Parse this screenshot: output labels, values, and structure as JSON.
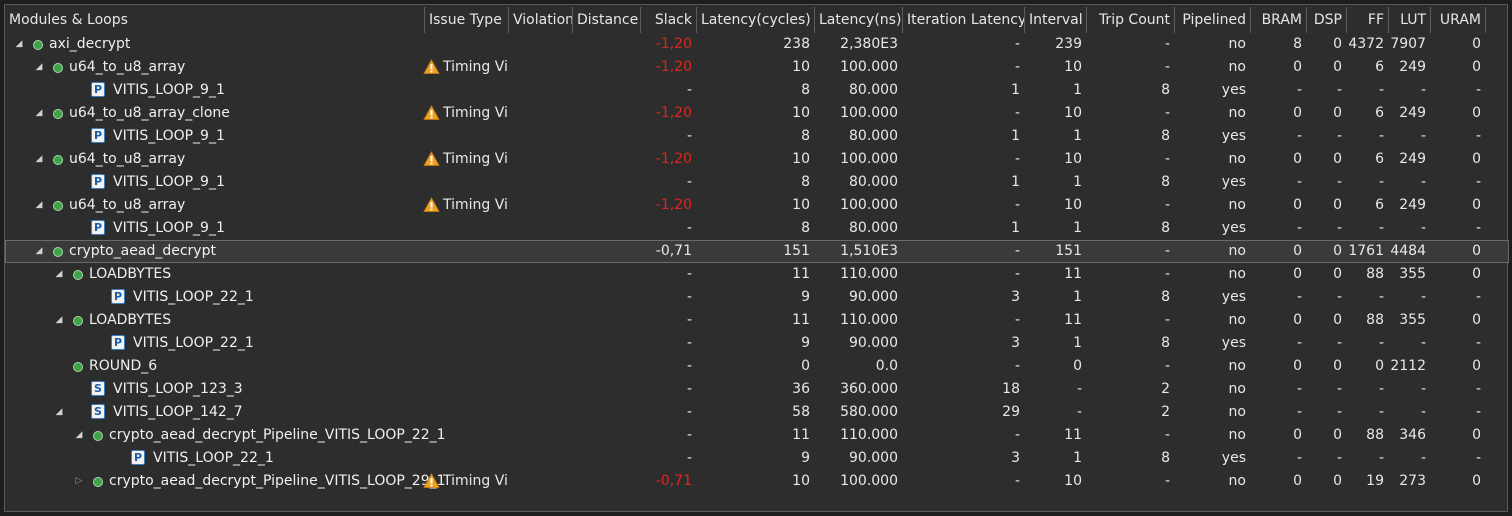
{
  "headers": [
    "Modules & Loops",
    "Issue Type",
    "Violation",
    "Distance",
    "Slack",
    "Latency(cycles)",
    "Latency(ns)",
    "Iteration Latency",
    "Interval",
    "Trip Count",
    "Pipelined",
    "BRAM",
    "DSP",
    "FF",
    "LUT",
    "URAM"
  ],
  "colors": {
    "negative_slack": "#e0251c",
    "module_dot": "#3fa24a",
    "warning": "#f0a020"
  },
  "icons": {
    "expanded": "triangle-down-icon",
    "collapsed": "triangle-right-icon",
    "module": "module-dot-icon",
    "pipelined_loop": "pipelined-loop-icon",
    "sequential_loop": "sequential-loop-icon",
    "warning": "warning-icon"
  },
  "rows": [
    {
      "level": 0,
      "arrow": "expanded",
      "icon": "dot",
      "name": "axi_decrypt",
      "issue": "",
      "slack": "-1,20",
      "lat_cycles": "238",
      "lat_ns": "2,380E3",
      "iter_lat": "-",
      "interval": "239",
      "trip": "-",
      "pipelined": "no",
      "bram": "8",
      "dsp": "0",
      "ff": "4372",
      "lut": "7907",
      "uram": "0"
    },
    {
      "level": 1,
      "arrow": "expanded",
      "icon": "dot",
      "name": "u64_to_u8_array",
      "issue": "Timing Vi",
      "slack": "-1,20",
      "lat_cycles": "10",
      "lat_ns": "100.000",
      "iter_lat": "-",
      "interval": "10",
      "trip": "-",
      "pipelined": "no",
      "bram": "0",
      "dsp": "0",
      "ff": "6",
      "lut": "249",
      "uram": "0"
    },
    {
      "level": 2,
      "arrow": "",
      "icon": "P",
      "name": "VITIS_LOOP_9_1",
      "issue": "",
      "slack": "-",
      "lat_cycles": "8",
      "lat_ns": "80.000",
      "iter_lat": "1",
      "interval": "1",
      "trip": "8",
      "pipelined": "yes",
      "bram": "-",
      "dsp": "-",
      "ff": "-",
      "lut": "-",
      "uram": "-"
    },
    {
      "level": 1,
      "arrow": "expanded",
      "icon": "dot",
      "name": "u64_to_u8_array_clone",
      "issue": "Timing Vi",
      "slack": "-1,20",
      "lat_cycles": "10",
      "lat_ns": "100.000",
      "iter_lat": "-",
      "interval": "10",
      "trip": "-",
      "pipelined": "no",
      "bram": "0",
      "dsp": "0",
      "ff": "6",
      "lut": "249",
      "uram": "0"
    },
    {
      "level": 2,
      "arrow": "",
      "icon": "P",
      "name": "VITIS_LOOP_9_1",
      "issue": "",
      "slack": "-",
      "lat_cycles": "8",
      "lat_ns": "80.000",
      "iter_lat": "1",
      "interval": "1",
      "trip": "8",
      "pipelined": "yes",
      "bram": "-",
      "dsp": "-",
      "ff": "-",
      "lut": "-",
      "uram": "-"
    },
    {
      "level": 1,
      "arrow": "expanded",
      "icon": "dot",
      "name": "u64_to_u8_array",
      "issue": "Timing Vi",
      "slack": "-1,20",
      "lat_cycles": "10",
      "lat_ns": "100.000",
      "iter_lat": "-",
      "interval": "10",
      "trip": "-",
      "pipelined": "no",
      "bram": "0",
      "dsp": "0",
      "ff": "6",
      "lut": "249",
      "uram": "0"
    },
    {
      "level": 2,
      "arrow": "",
      "icon": "P",
      "name": "VITIS_LOOP_9_1",
      "issue": "",
      "slack": "-",
      "lat_cycles": "8",
      "lat_ns": "80.000",
      "iter_lat": "1",
      "interval": "1",
      "trip": "8",
      "pipelined": "yes",
      "bram": "-",
      "dsp": "-",
      "ff": "-",
      "lut": "-",
      "uram": "-"
    },
    {
      "level": 1,
      "arrow": "expanded",
      "icon": "dot",
      "name": "u64_to_u8_array",
      "issue": "Timing Vi",
      "slack": "-1,20",
      "lat_cycles": "10",
      "lat_ns": "100.000",
      "iter_lat": "-",
      "interval": "10",
      "trip": "-",
      "pipelined": "no",
      "bram": "0",
      "dsp": "0",
      "ff": "6",
      "lut": "249",
      "uram": "0"
    },
    {
      "level": 2,
      "arrow": "",
      "icon": "P",
      "name": "VITIS_LOOP_9_1",
      "issue": "",
      "slack": "-",
      "lat_cycles": "8",
      "lat_ns": "80.000",
      "iter_lat": "1",
      "interval": "1",
      "trip": "8",
      "pipelined": "yes",
      "bram": "-",
      "dsp": "-",
      "ff": "-",
      "lut": "-",
      "uram": "-"
    },
    {
      "level": 1,
      "arrow": "expanded",
      "icon": "dot",
      "name": "crypto_aead_decrypt",
      "issue": "",
      "slack": "-0,71",
      "slack_plain": true,
      "selected": true,
      "lat_cycles": "151",
      "lat_ns": "1,510E3",
      "iter_lat": "-",
      "interval": "151",
      "trip": "-",
      "pipelined": "no",
      "bram": "0",
      "dsp": "0",
      "ff": "1761",
      "lut": "4484",
      "uram": "0"
    },
    {
      "level": 2,
      "arrow": "expanded",
      "icon": "dot",
      "name": "LOADBYTES",
      "issue": "",
      "slack": "-",
      "lat_cycles": "11",
      "lat_ns": "110.000",
      "iter_lat": "-",
      "interval": "11",
      "trip": "-",
      "pipelined": "no",
      "bram": "0",
      "dsp": "0",
      "ff": "88",
      "lut": "355",
      "uram": "0"
    },
    {
      "level": 3,
      "arrow": "",
      "icon": "P",
      "name": "VITIS_LOOP_22_1",
      "issue": "",
      "slack": "-",
      "lat_cycles": "9",
      "lat_ns": "90.000",
      "iter_lat": "3",
      "interval": "1",
      "trip": "8",
      "pipelined": "yes",
      "bram": "-",
      "dsp": "-",
      "ff": "-",
      "lut": "-",
      "uram": "-"
    },
    {
      "level": 2,
      "arrow": "expanded",
      "icon": "dot",
      "name": "LOADBYTES",
      "issue": "",
      "slack": "-",
      "lat_cycles": "11",
      "lat_ns": "110.000",
      "iter_lat": "-",
      "interval": "11",
      "trip": "-",
      "pipelined": "no",
      "bram": "0",
      "dsp": "0",
      "ff": "88",
      "lut": "355",
      "uram": "0"
    },
    {
      "level": 3,
      "arrow": "",
      "icon": "P",
      "name": "VITIS_LOOP_22_1",
      "issue": "",
      "slack": "-",
      "lat_cycles": "9",
      "lat_ns": "90.000",
      "iter_lat": "3",
      "interval": "1",
      "trip": "8",
      "pipelined": "yes",
      "bram": "-",
      "dsp": "-",
      "ff": "-",
      "lut": "-",
      "uram": "-"
    },
    {
      "level": 2,
      "arrow": "",
      "icon": "dot",
      "name": "ROUND_6",
      "issue": "",
      "slack": "-",
      "lat_cycles": "0",
      "lat_ns": "0.0",
      "iter_lat": "-",
      "interval": "0",
      "trip": "-",
      "pipelined": "no",
      "bram": "0",
      "dsp": "0",
      "ff": "0",
      "lut": "2112",
      "uram": "0"
    },
    {
      "level": 2,
      "arrow": "",
      "icon": "S",
      "name": "VITIS_LOOP_123_3",
      "issue": "",
      "slack": "-",
      "lat_cycles": "36",
      "lat_ns": "360.000",
      "iter_lat": "18",
      "interval": "-",
      "trip": "2",
      "pipelined": "no",
      "bram": "-",
      "dsp": "-",
      "ff": "-",
      "lut": "-",
      "uram": "-"
    },
    {
      "level": 2,
      "arrow": "expanded",
      "icon": "S",
      "name": "VITIS_LOOP_142_7",
      "issue": "",
      "slack": "-",
      "lat_cycles": "58",
      "lat_ns": "580.000",
      "iter_lat": "29",
      "interval": "-",
      "trip": "2",
      "pipelined": "no",
      "bram": "-",
      "dsp": "-",
      "ff": "-",
      "lut": "-",
      "uram": "-"
    },
    {
      "level": 3,
      "arrow": "expanded",
      "icon": "dot",
      "name": "crypto_aead_decrypt_Pipeline_VITIS_LOOP_22_1",
      "issue": "",
      "slack": "-",
      "lat_cycles": "11",
      "lat_ns": "110.000",
      "iter_lat": "-",
      "interval": "11",
      "trip": "-",
      "pipelined": "no",
      "bram": "0",
      "dsp": "0",
      "ff": "88",
      "lut": "346",
      "uram": "0"
    },
    {
      "level": 4,
      "arrow": "",
      "icon": "P",
      "name": "VITIS_LOOP_22_1",
      "issue": "",
      "slack": "-",
      "lat_cycles": "9",
      "lat_ns": "90.000",
      "iter_lat": "3",
      "interval": "1",
      "trip": "8",
      "pipelined": "yes",
      "bram": "-",
      "dsp": "-",
      "ff": "-",
      "lut": "-",
      "uram": "-"
    },
    {
      "level": 3,
      "arrow": "collapsed",
      "icon": "dot",
      "name": "crypto_aead_decrypt_Pipeline_VITIS_LOOP_29_1",
      "issue": "Timing Vi",
      "slack": "-0,71",
      "lat_cycles": "10",
      "lat_ns": "100.000",
      "iter_lat": "-",
      "interval": "10",
      "trip": "-",
      "pipelined": "no",
      "bram": "0",
      "dsp": "0",
      "ff": "19",
      "lut": "273",
      "uram": "0"
    }
  ]
}
